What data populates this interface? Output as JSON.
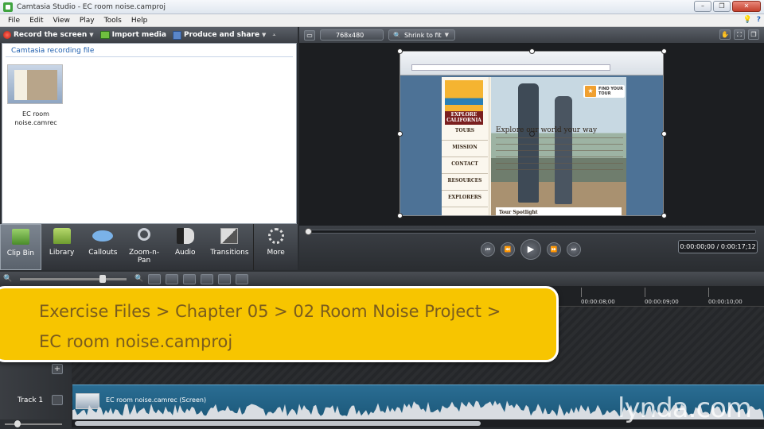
{
  "window": {
    "title": "Camtasia Studio - EC room noise.camproj",
    "buttons": [
      "–",
      "❐",
      "✕"
    ]
  },
  "menu": {
    "items": [
      "File",
      "Edit",
      "View",
      "Play",
      "Tools",
      "Help"
    ]
  },
  "left_toolbar": {
    "record_label": "Record the screen",
    "import_label": "Import media",
    "produce_label": "Produce and share"
  },
  "clip_bin": {
    "header": "Camtasia recording file",
    "items": [
      {
        "name_line1": "EC room",
        "name_line2": "noise.camrec"
      }
    ]
  },
  "task_tabs": [
    {
      "label": "Clip Bin",
      "icon": "clip-bin-icon"
    },
    {
      "label": "Library",
      "icon": "library-icon"
    },
    {
      "label": "Callouts",
      "icon": "callouts-icon"
    },
    {
      "label": "Zoom-n-Pan",
      "icon": "zoom-icon"
    },
    {
      "label": "Audio",
      "icon": "audio-icon"
    },
    {
      "label": "Transitions",
      "icon": "transitions-icon"
    },
    {
      "label": "More",
      "icon": "more-icon"
    }
  ],
  "preview_toolbar": {
    "size": "768x480",
    "fit": "Shrink to fit"
  },
  "preview_content": {
    "logo_line1": "EXPLORE",
    "logo_line2": "CALIFORNIA",
    "nav": [
      "TOURS",
      "MISSION",
      "CONTACT",
      "RESOURCES",
      "EXPLORERS"
    ],
    "headline": "Explore our world your way",
    "badge_line1": "FIND YOUR",
    "badge_line2": "TOUR",
    "spotlight": "Tour Spotlight"
  },
  "playback": {
    "timecode": "0:00:00;00 / 0:00:17;12",
    "progress": 0.0
  },
  "timeline": {
    "ruler_ticks": [
      "00:00:08;00",
      "00:00:09;00",
      "00:00:10;00"
    ],
    "track_label": "Track 1",
    "clip_label": "EC room noise.camrec (Screen)"
  },
  "banner": {
    "line1": "Exercise Files > Chapter 05 > 02 Room Noise Project >",
    "line2": "EC room noise.camproj"
  },
  "watermark": "lynda.com",
  "colors": {
    "banner": "#f7c500",
    "banner_text": "#7a5c1e",
    "clip": "#1c5879"
  }
}
